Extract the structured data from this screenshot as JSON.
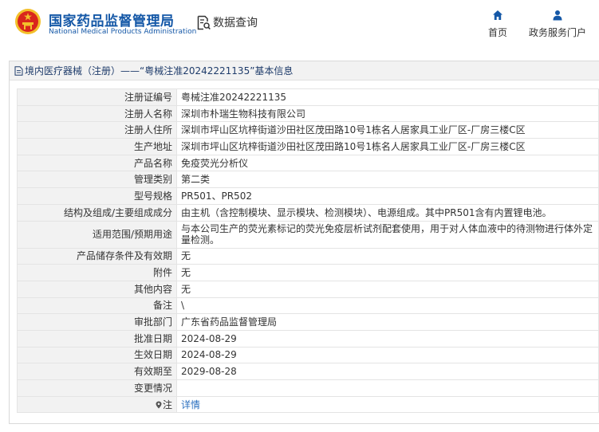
{
  "header": {
    "title_cn": "国家药品监督管理局",
    "title_en": "National Medical Products Administration",
    "query_label": "数据查询",
    "nav": [
      {
        "label": "首页",
        "icon": "home-icon"
      },
      {
        "label": "政务服务门户",
        "icon": "user-icon"
      }
    ]
  },
  "panel": {
    "title": "境内医疗器械（注册）——“粤械注准20242221135”基本信息"
  },
  "rows": [
    {
      "key": "注册证编号",
      "value": "粤械注准20242221135"
    },
    {
      "key": "注册人名称",
      "value": "深圳市朴瑞生物科技有限公司"
    },
    {
      "key": "注册人住所",
      "value": "深圳市坪山区坑梓街道沙田社区茂田路10号1栋名人居家具工业厂区-厂房三楼C区"
    },
    {
      "key": "生产地址",
      "value": "深圳市坪山区坑梓街道沙田社区茂田路10号1栋名人居家具工业厂区-厂房三楼C区"
    },
    {
      "key": "产品名称",
      "value": "免疫荧光分析仪"
    },
    {
      "key": "管理类别",
      "value": "第二类"
    },
    {
      "key": "型号规格",
      "value": "PR501、PR502"
    },
    {
      "key": "结构及组成/主要组成成分",
      "value": "由主机（含控制模块、显示模块、检测模块）、电源组成。其中PR501含有内置锂电池。"
    },
    {
      "key": "适用范围/预期用途",
      "value": "与本公司生产的荧光素标记的荧光免疫层析试剂配套使用，用于对人体血液中的待测物进行体外定量检测。"
    },
    {
      "key": "产品储存条件及有效期",
      "value": "无"
    },
    {
      "key": "附件",
      "value": "无"
    },
    {
      "key": "其他内容",
      "value": "无"
    },
    {
      "key": "备注",
      "value": "\\"
    },
    {
      "key": "审批部门",
      "value": "广东省药品监督管理局"
    },
    {
      "key": "批准日期",
      "value": "2024-08-29"
    },
    {
      "key": "生效日期",
      "value": "2024-08-29"
    },
    {
      "key": "有效期至",
      "value": "2029-08-28"
    },
    {
      "key": "变更情况",
      "value": ""
    },
    {
      "key": "注",
      "value": "详情"
    }
  ],
  "colors": {
    "brand_blue": "#1558a7",
    "link_blue": "#2a6fbf",
    "emblem_red": "#d9261c",
    "emblem_gold": "#f3c02b"
  }
}
